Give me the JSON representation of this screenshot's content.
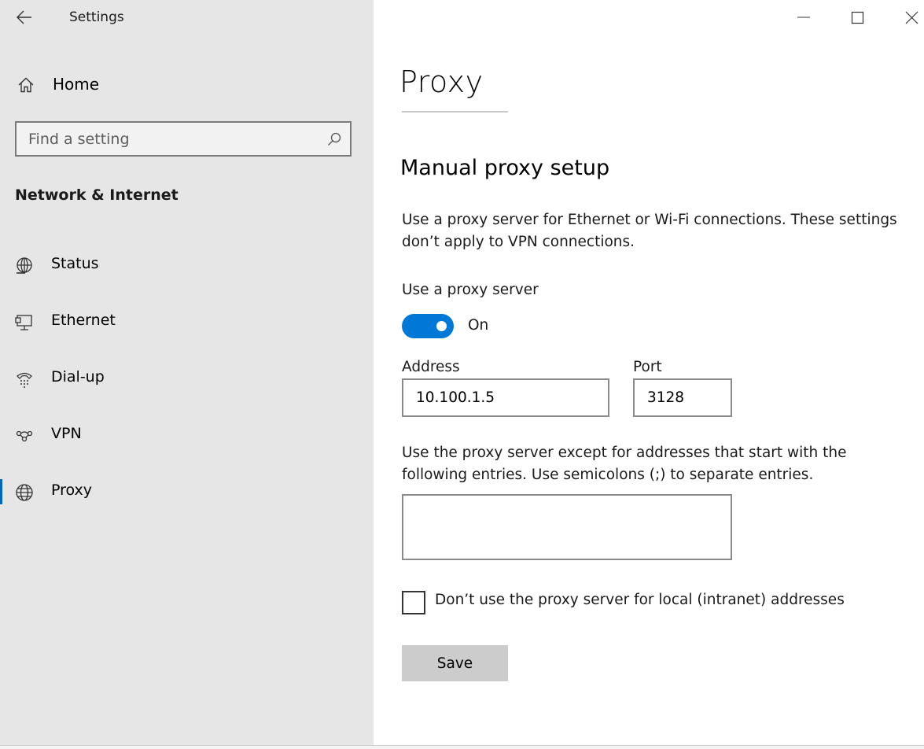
{
  "window": {
    "title": "Settings"
  },
  "sidebar": {
    "home_label": "Home",
    "search_placeholder": "Find a setting",
    "section_title": "Network & Internet",
    "items": [
      {
        "label": "Status",
        "icon": "globe-status-icon"
      },
      {
        "label": "Ethernet",
        "icon": "ethernet-icon"
      },
      {
        "label": "Dial-up",
        "icon": "dial-up-icon"
      },
      {
        "label": "VPN",
        "icon": "vpn-icon"
      },
      {
        "label": "Proxy",
        "icon": "globe-icon",
        "selected": true
      }
    ]
  },
  "main": {
    "page_title": "Proxy",
    "section_title": "Manual proxy setup",
    "description": "Use a proxy server for Ethernet or Wi-Fi connections. These settings don’t apply to VPN connections.",
    "use_proxy_label": "Use a proxy server",
    "toggle_state": "On",
    "address_label": "Address",
    "address_value": "10.100.1.5",
    "port_label": "Port",
    "port_value": "3128",
    "exceptions_text": "Use the proxy server except for addresses that start with the following entries. Use semicolons (;) to separate entries.",
    "exceptions_value": "",
    "local_checkbox_label": "Don’t use the proxy server for local (intranet) addresses",
    "local_checkbox_checked": false,
    "save_label": "Save"
  },
  "colors": {
    "accent": "#0078d7",
    "sidebar_bg": "#e6e6e6",
    "button_bg": "#cccccc"
  }
}
